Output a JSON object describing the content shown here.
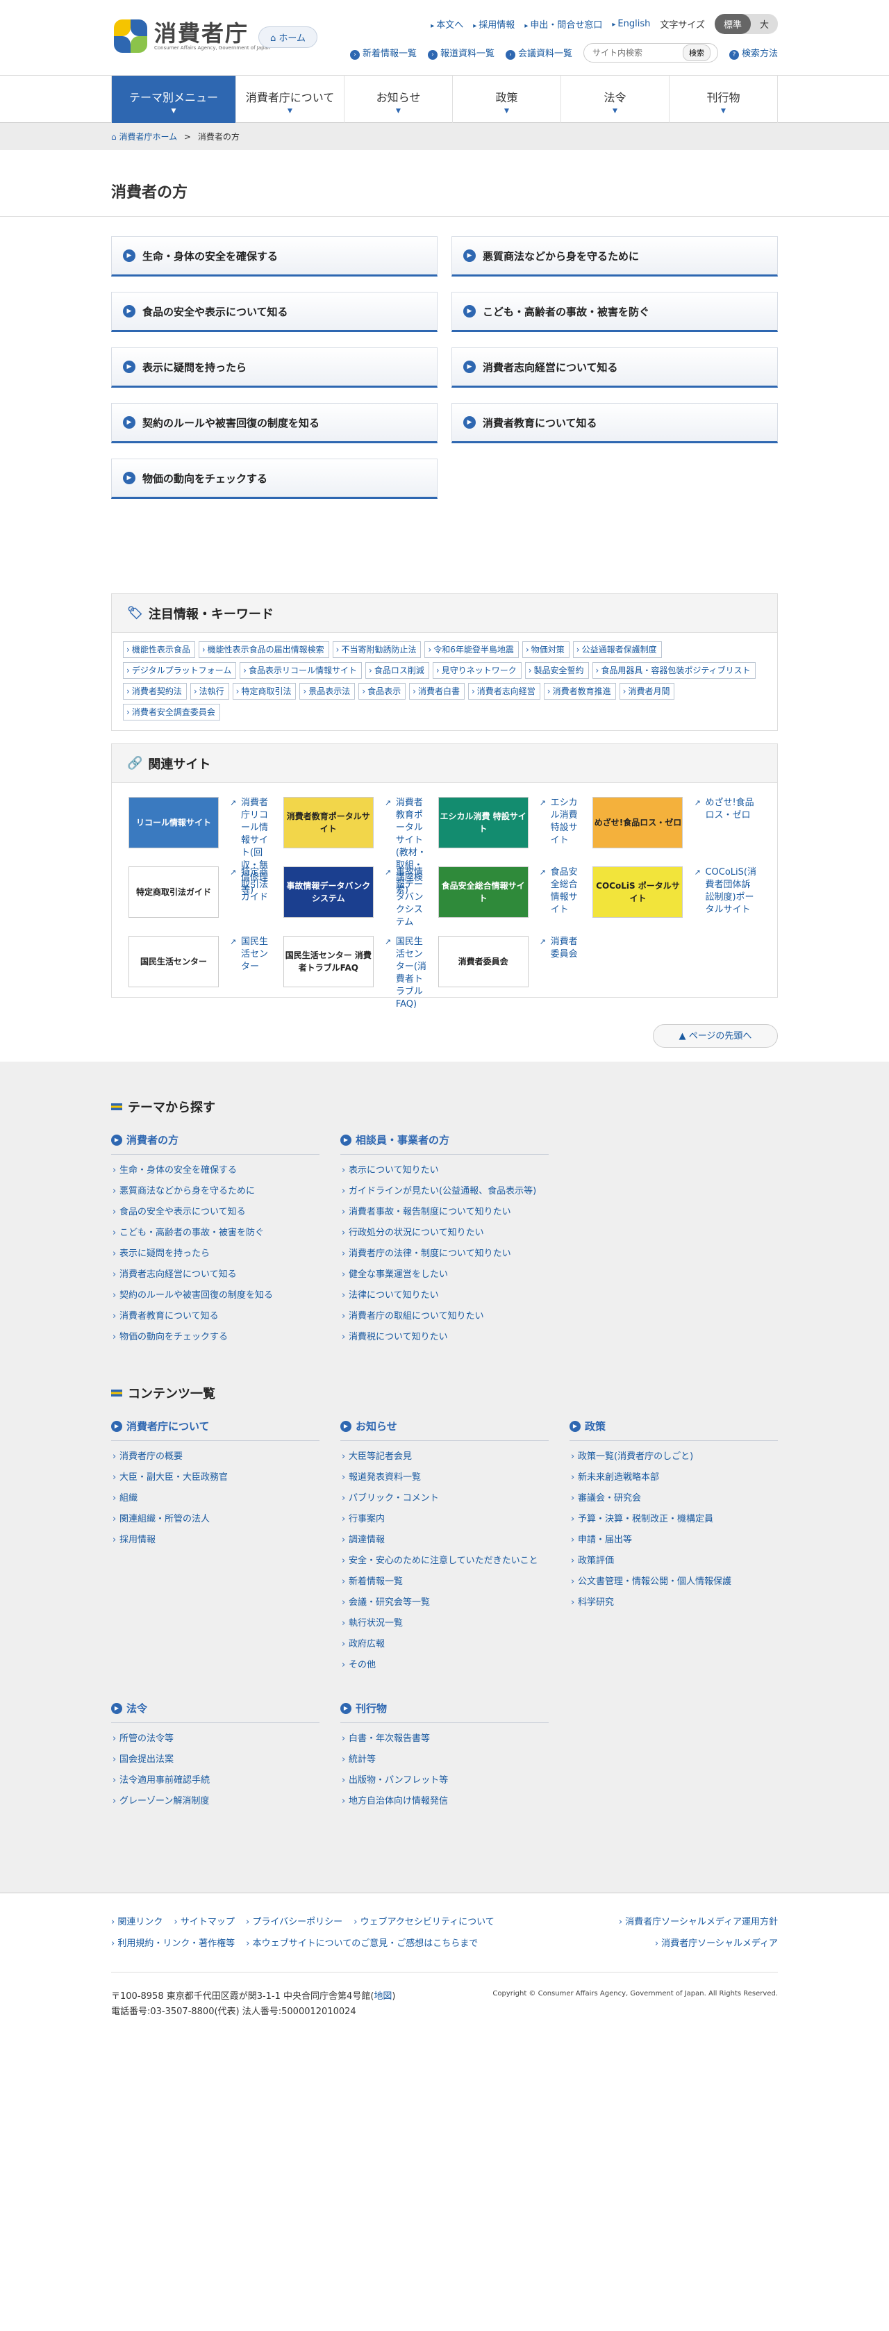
{
  "header": {
    "logo_text": "消費者庁",
    "logo_en": "Consumer Affairs Agency, Government of Japan",
    "home": "ホーム",
    "util_links": [
      "本文へ",
      "採用情報",
      "申出・問合せ窓口",
      "English"
    ],
    "font_size_label": "文字サイズ",
    "font_size_options": [
      "標準",
      "大"
    ],
    "sub_links": [
      "新着情報一覧",
      "報道資料一覧",
      "会議資料一覧"
    ],
    "search_placeholder": "サイト内検索",
    "search_button": "検索",
    "search_method": "検索方法"
  },
  "gnav": [
    "テーマ別メニュー",
    "消費者庁について",
    "お知らせ",
    "政策",
    "法令",
    "刊行物"
  ],
  "breadcrumb": {
    "home": "消費者庁ホーム",
    "sep": ">",
    "current": "消費者の方"
  },
  "page_title": "消費者の方",
  "categories": [
    "生命・身体の安全を確保する",
    "悪質商法などから身を守るために",
    "食品の安全や表示について知る",
    "こども・高齢者の事故・被害を防ぐ",
    "表示に疑問を持ったら",
    "消費者志向経営について知る",
    "契約のルールや被害回復の制度を知る",
    "消費者教育について知る",
    "物価の動向をチェックする"
  ],
  "keywords": {
    "title": "注目情報・キーワード",
    "tags": [
      "機能性表示食品",
      "機能性表示食品の届出情報検索",
      "不当寄附勧誘防止法",
      "令和6年能登半島地震",
      "物価対策",
      "公益通報者保護制度",
      "デジタルプラットフォーム",
      "食品表示リコール情報サイト",
      "食品ロス削減",
      "見守りネットワーク",
      "製品安全誓約",
      "食品用器具・容器包装ポジティブリスト",
      "消費者契約法",
      "法執行",
      "特定商取引法",
      "景品表示法",
      "食品表示",
      "消費者白書",
      "消費者志向経営",
      "消費者教育推進",
      "消費者月間",
      "消費者安全調査委員会"
    ]
  },
  "related": {
    "title": "関連サイト",
    "sites": [
      {
        "banner": "リコール情報サイト",
        "label": "消費者庁リコール情報サイト(回収・無償修理等)",
        "color": "#3a7ac0"
      },
      {
        "banner": "消費者教育ポータルサイト",
        "label": "消費者教育ポータルサイト(教材・取組・講座検索)",
        "color": "#f2d64a"
      },
      {
        "banner": "エシカル消費 特設サイト",
        "label": "エシカル消費特設サイト",
        "color": "#138c6f"
      },
      {
        "banner": "めざせ!食品ロス・ゼロ",
        "label": "めざせ!食品ロス・ゼロ",
        "color": "#f4b13c"
      },
      {
        "banner": "特定商取引法ガイド",
        "label": "特定商取引法ガイド",
        "color": "#ffffff"
      },
      {
        "banner": "事故情報データバンクシステム",
        "label": "事故情報データバンクシステム",
        "color": "#1b3f8f"
      },
      {
        "banner": "食品安全総合情報サイト",
        "label": "食品安全総合情報サイト",
        "color": "#2f8a3a"
      },
      {
        "banner": "COCoLiS ポータルサイト",
        "label": "COCoLiS(消費者団体訴訟制度)ポータルサイト",
        "color": "#f2e43b"
      },
      {
        "banner": "国民生活センター",
        "label": "国民生活センター",
        "color": "#ffffff"
      },
      {
        "banner": "国民生活センター 消費者トラブルFAQ",
        "label": "国民生活センター(消費者トラブルFAQ)",
        "color": "#ffffff"
      },
      {
        "banner": "消費者委員会",
        "label": "消費者委員会",
        "color": "#ffffff"
      }
    ]
  },
  "pagetop": "ページの先頭へ",
  "theme_section": {
    "title": "テーマから探す",
    "cols": [
      {
        "title": "消費者の方",
        "items": [
          "生命・身体の安全を確保する",
          "悪質商法などから身を守るために",
          "食品の安全や表示について知る",
          "こども・高齢者の事故・被害を防ぐ",
          "表示に疑問を持ったら",
          "消費者志向経営について知る",
          "契約のルールや被害回復の制度を知る",
          "消費者教育について知る",
          "物価の動向をチェックする"
        ]
      },
      {
        "title": "相談員・事業者の方",
        "items": [
          "表示について知りたい",
          "ガイドラインが見たい(公益通報、食品表示等)",
          "消費者事故・報告制度について知りたい",
          "行政処分の状況について知りたい",
          "消費者庁の法律・制度について知りたい",
          "健全な事業運営をしたい",
          "法律について知りたい",
          "消費者庁の取組について知りたい",
          "消費税について知りたい"
        ]
      }
    ]
  },
  "contents_section": {
    "title": "コンテンツ一覧",
    "cols": [
      {
        "title": "消費者庁について",
        "items": [
          "消費者庁の概要",
          "大臣・副大臣・大臣政務官",
          "組織",
          "関連組織・所管の法人",
          "採用情報"
        ]
      },
      {
        "title": "お知らせ",
        "items": [
          "大臣等記者会見",
          "報道発表資料一覧",
          "パブリック・コメント",
          "行事案内",
          "調達情報",
          "安全・安心のために注意していただきたいこと",
          "新着情報一覧",
          "会議・研究会等一覧",
          "執行状況一覧",
          "政府広報",
          "その他"
        ]
      },
      {
        "title": "政策",
        "items": [
          "政策一覧(消費者庁のしごと)",
          "新未来創造戦略本部",
          "審議会・研究会",
          "予算・決算・税制改正・機構定員",
          "申請・届出等",
          "政策評価",
          "公文書管理・情報公開・個人情報保護",
          "科学研究"
        ]
      },
      {
        "title": "法令",
        "items": [
          "所管の法令等",
          "国会提出法案",
          "法令適用事前確認手続",
          "グレーゾーン解消制度"
        ]
      },
      {
        "title": "刊行物",
        "items": [
          "白書・年次報告書等",
          "統計等",
          "出版物・パンフレット等",
          "地方自治体向け情報発信"
        ]
      }
    ]
  },
  "footer": {
    "links_row1": [
      "関連リンク",
      "サイトマップ",
      "プライバシーポリシー",
      "ウェブアクセシビリティについて"
    ],
    "links_row2": [
      "利用規約・リンク・著作権等",
      "本ウェブサイトについてのご意見・ご感想はこちらまで"
    ],
    "links_right": [
      "消費者庁ソーシャルメディア運用方針",
      "消費者庁ソーシャルメディア"
    ],
    "address": "〒100-8958 東京都千代田区霞が関3-1-1 中央合同庁舎第4号館(",
    "map": "地図",
    "address_end": ")",
    "phone": "電話番号:03-3507-8800(代表)  法人番号:5000012010024",
    "copyright": "Copyright © Consumer Affairs Agency, Government of Japan. All Rights Reserved."
  }
}
